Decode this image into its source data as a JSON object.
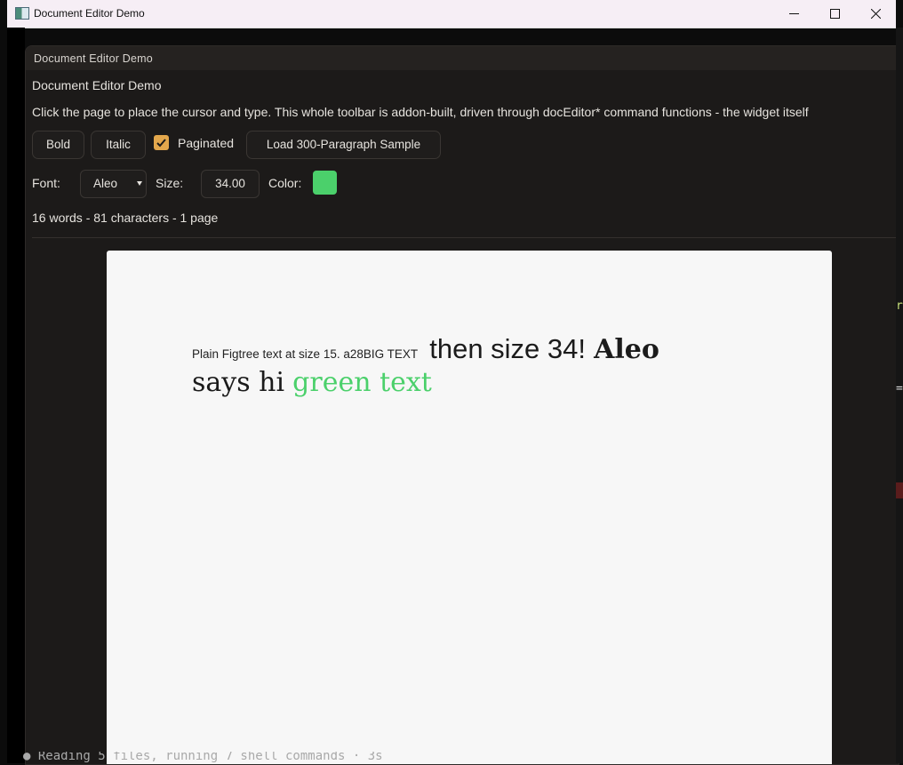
{
  "window": {
    "title": "Document Editor Demo",
    "minimize_glyph": "—",
    "close_glyph": "✕"
  },
  "app": {
    "header_title": "Document Editor Demo",
    "heading": "Document Editor Demo",
    "instructions": "Click the page to place the cursor and type. This whole toolbar is addon-built, driven through docEditor* command functions - the widget itself",
    "toolbar": {
      "bold_label": "Bold",
      "italic_label": "Italic",
      "paginated_label": "Paginated",
      "paginated_checked": true,
      "load_sample_label": "Load 300-Paragraph Sample"
    },
    "format": {
      "font_label": "Font:",
      "font_value": "Aleo",
      "size_label": "Size:",
      "size_value": "34.00",
      "color_label": "Color:",
      "color_value": "#4bd06b"
    },
    "stats": "16 words - 81 characters - 1 page"
  },
  "document": {
    "line1_small": "Plain Figtree text at size 15. a28BIG TEXT",
    "line1_big": "then size 34!",
    "line1_aleo": "Aleo",
    "line2_aleo": "says hi",
    "line2_green": "green text",
    "green_color": "#4bd06b"
  },
  "terminal": {
    "status_line": "● Reading 5 files, running 7 shell commands · 3s"
  }
}
